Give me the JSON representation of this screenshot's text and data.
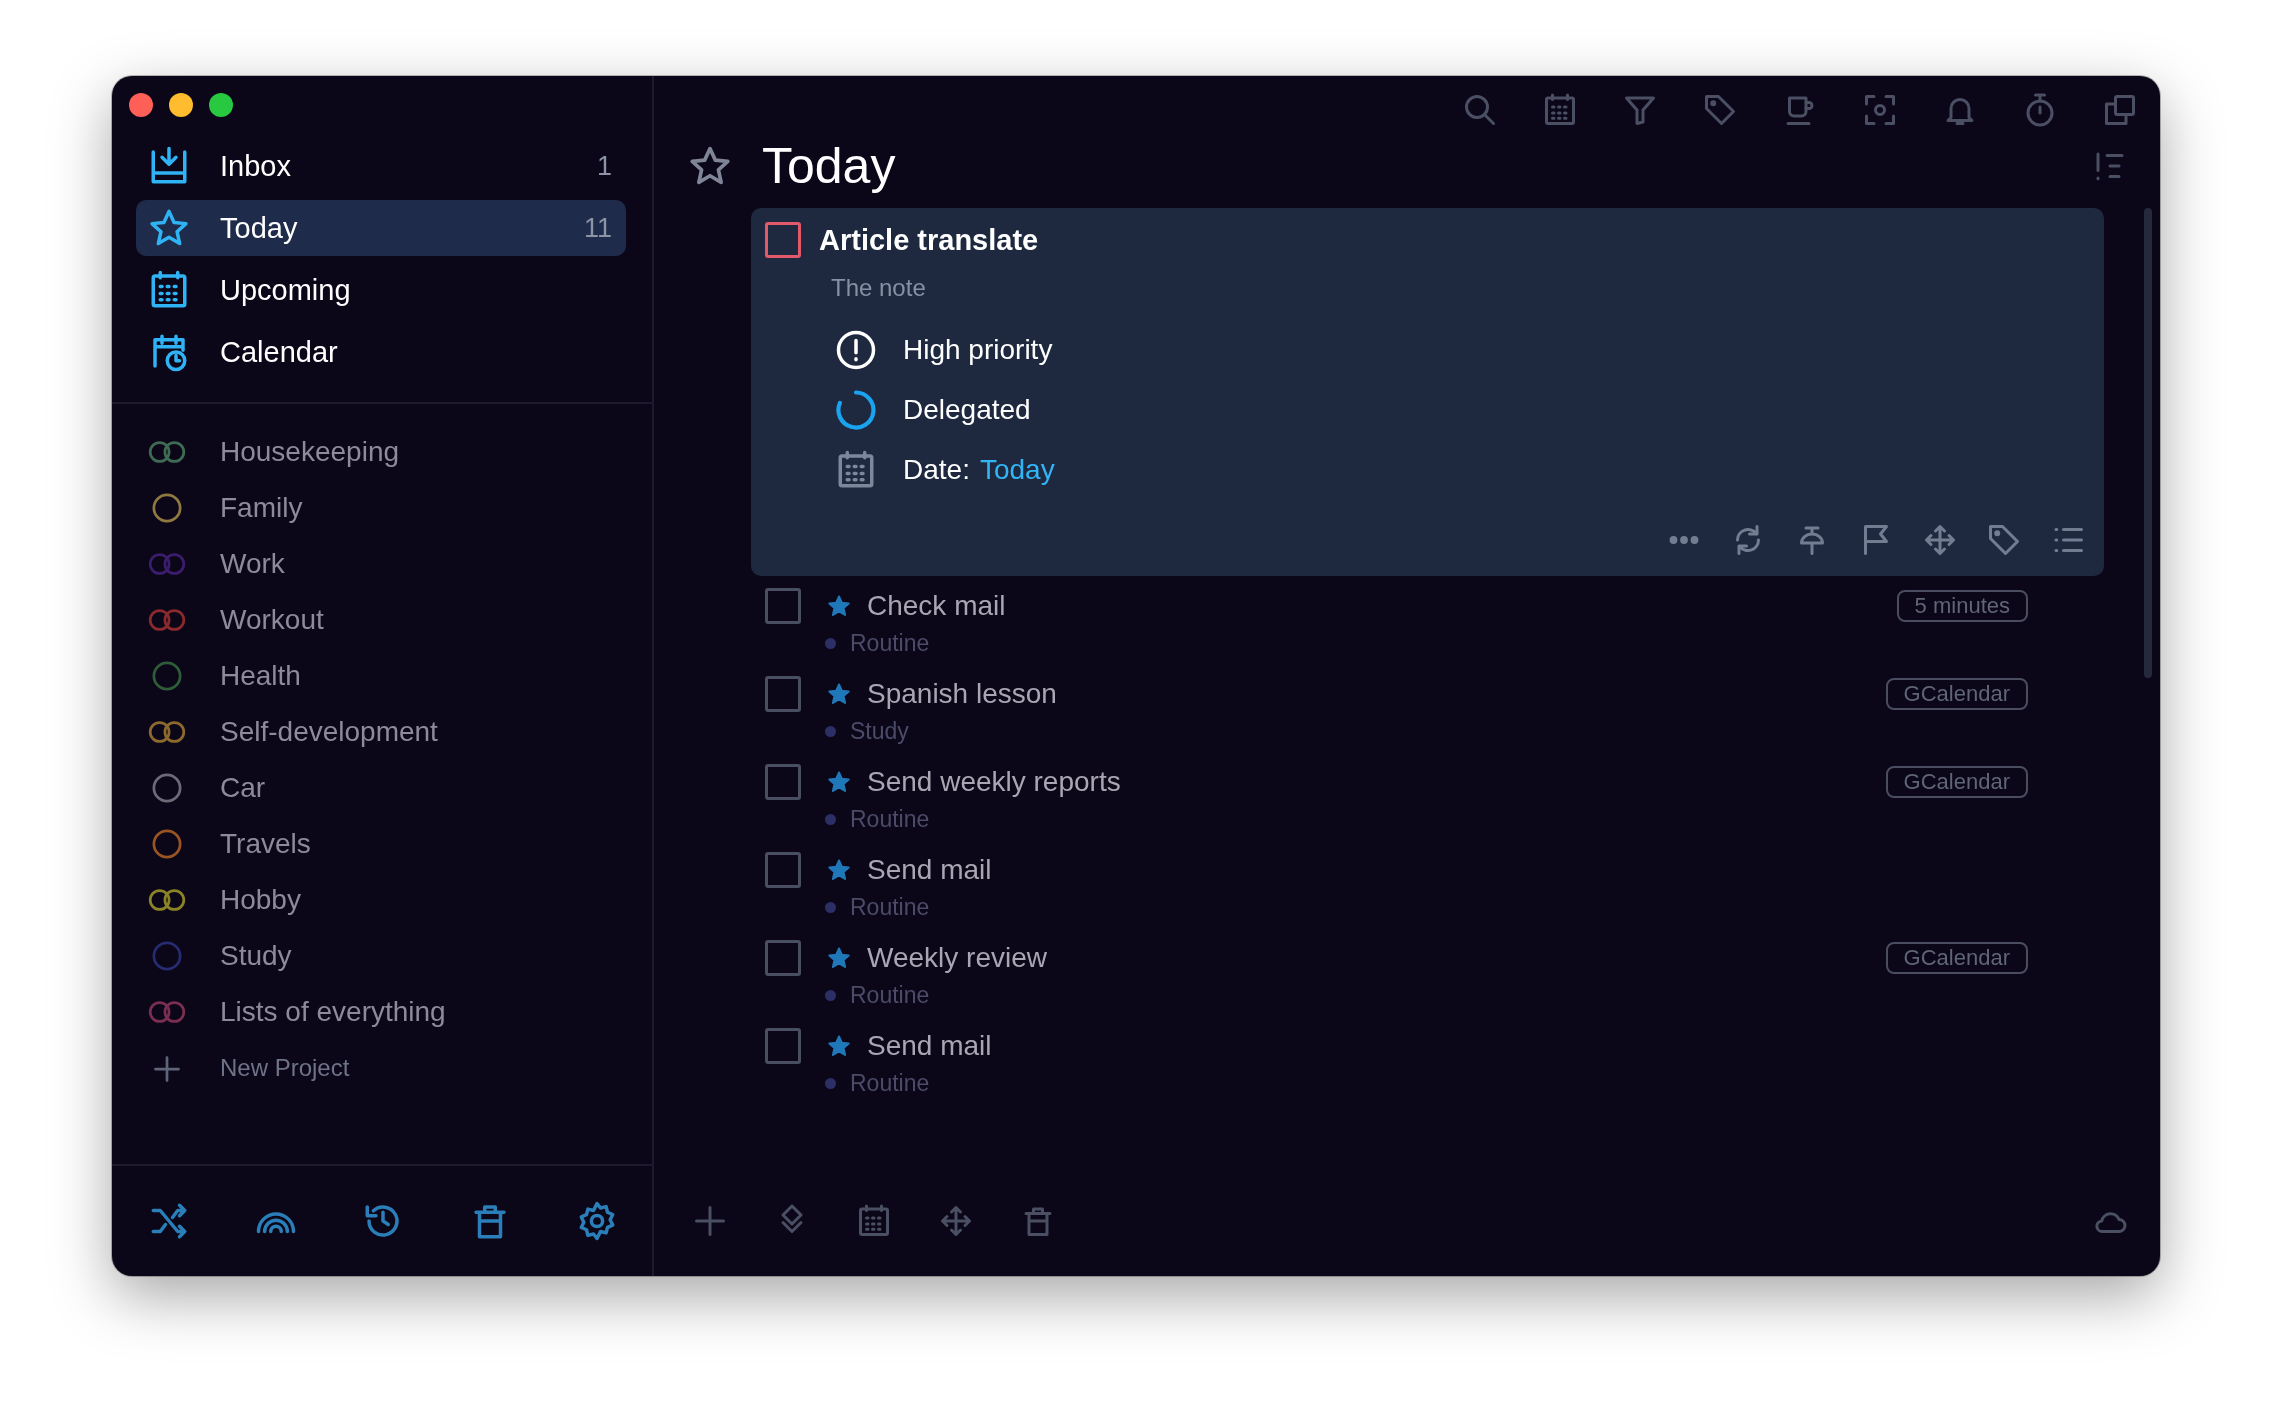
{
  "sidebar": {
    "items": [
      {
        "label": "Inbox",
        "count": "1",
        "selected": false,
        "kind": "inbox"
      },
      {
        "label": "Today",
        "count": "11",
        "selected": true,
        "kind": "today"
      },
      {
        "label": "Upcoming",
        "selected": false,
        "kind": "upcoming"
      },
      {
        "label": "Calendar",
        "selected": false,
        "kind": "calendar"
      }
    ],
    "projects": [
      {
        "label": "Housekeeping",
        "kind": "double",
        "color": "#3e6b52"
      },
      {
        "label": "Family",
        "kind": "single",
        "color": "#8e7a40"
      },
      {
        "label": "Work",
        "kind": "double",
        "color": "#3c1c6c"
      },
      {
        "label": "Workout",
        "kind": "double",
        "color": "#8a2a2c"
      },
      {
        "label": "Health",
        "kind": "single",
        "color": "#2f5d3a"
      },
      {
        "label": "Self-development",
        "kind": "double",
        "color": "#8c6a2e"
      },
      {
        "label": "Car",
        "kind": "single",
        "color": "#6d6a78"
      },
      {
        "label": "Travels",
        "kind": "single",
        "color": "#9a5424"
      },
      {
        "label": "Hobby",
        "kind": "double",
        "color": "#8a8426"
      },
      {
        "label": "Study",
        "kind": "single",
        "color": "#272b70"
      },
      {
        "label": "Lists of everything",
        "kind": "double",
        "color": "#7a2e52"
      }
    ],
    "new_project": "New Project"
  },
  "main": {
    "title": "Today",
    "open_task": {
      "title": "Article translate",
      "checked": false,
      "note": "The note",
      "details": [
        {
          "kind": "priority",
          "label": "High priority"
        },
        {
          "kind": "delegated",
          "label": "Delegated"
        },
        {
          "kind": "date",
          "label": "Date:",
          "value": "Today"
        }
      ]
    },
    "tasks": [
      {
        "title": "Check mail",
        "project": "Routine",
        "badge": "5 minutes",
        "checked": false
      },
      {
        "title": "Spanish lesson",
        "project": "Study",
        "badge": "GCalendar",
        "checked": false
      },
      {
        "title": "Send weekly reports",
        "project": "Routine",
        "badge": "GCalendar",
        "checked": false
      },
      {
        "title": "Send mail",
        "project": "Routine",
        "checked": false
      },
      {
        "title": "Weekly review",
        "project": "Routine",
        "badge": "GCalendar",
        "checked": false
      },
      {
        "title": "Send mail",
        "project": "Routine",
        "checked": false
      }
    ]
  }
}
